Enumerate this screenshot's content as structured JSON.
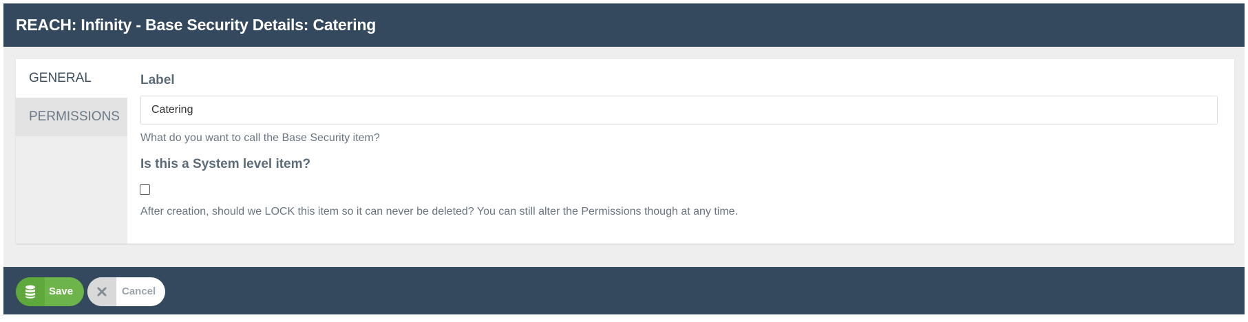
{
  "header": {
    "title": "REACH: Infinity - Base Security Details: Catering"
  },
  "tabs": [
    {
      "label": "GENERAL",
      "active": true
    },
    {
      "label": "PERMISSIONS",
      "active": false
    }
  ],
  "form": {
    "label_field": {
      "label": "Label",
      "value": "Catering",
      "help": "What do you want to call the Base Security item?"
    },
    "system_field": {
      "label": "Is this a System level item?",
      "checked": false,
      "help": "After creation, should we LOCK this item so it can never be deleted? You can still alter the Permissions though at any time."
    }
  },
  "footer": {
    "save_label": "Save",
    "save_icon": "database-icon",
    "cancel_label": "Cancel",
    "cancel_icon": "close-icon"
  },
  "colors": {
    "header_bg": "#34495e",
    "save_green": "#6db54b",
    "page_bg": "#eeeeee"
  }
}
